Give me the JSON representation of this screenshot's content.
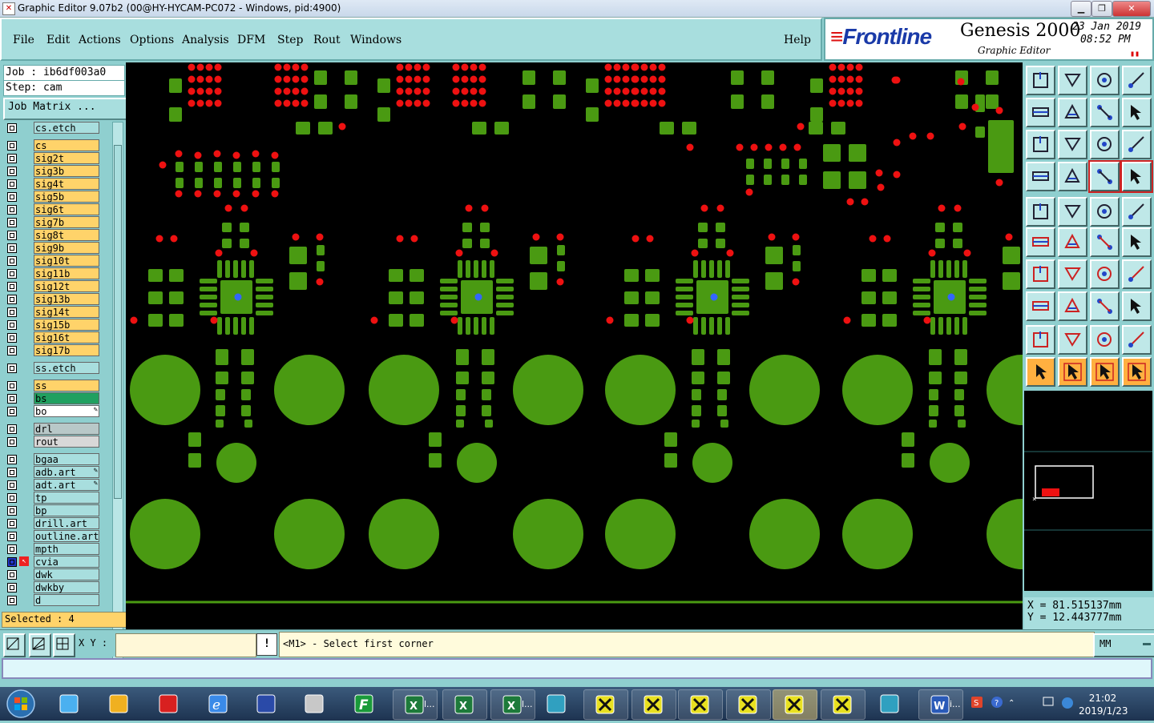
{
  "window": {
    "title": "Graphic Editor 9.07b2 (00@HY-HYCAM-PC072 - Windows, pid:4900)"
  },
  "menu": {
    "items": [
      "File",
      "Edit",
      "Actions",
      "Options",
      "Analysis",
      "DFM",
      "Step",
      "Rout",
      "Windows"
    ],
    "help": "Help"
  },
  "brand": {
    "logo": "Frontline",
    "product": "Genesis 2000",
    "subtitle": "Graphic Editor",
    "date": "23 Jan 2019",
    "time": "08:52 PM"
  },
  "job": {
    "job_label": "Job : ib6df003a0",
    "step_label": "Step: cam",
    "matrix_button": "Job Matrix ..."
  },
  "layers": [
    {
      "name": "cs.etch",
      "color": "#a8dede",
      "group": "a"
    },
    {
      "name": "cs",
      "color": "#ffd36a",
      "group": "b"
    },
    {
      "name": "sig2t",
      "color": "#ffd36a",
      "group": "b"
    },
    {
      "name": "sig3b",
      "color": "#ffd36a",
      "group": "b"
    },
    {
      "name": "sig4t",
      "color": "#ffd36a",
      "group": "b"
    },
    {
      "name": "sig5b",
      "color": "#ffd36a",
      "group": "b"
    },
    {
      "name": "sig6t",
      "color": "#ffd36a",
      "group": "b"
    },
    {
      "name": "sig7b",
      "color": "#ffd36a",
      "group": "b"
    },
    {
      "name": "sig8t",
      "color": "#ffd36a",
      "group": "b"
    },
    {
      "name": "sig9b",
      "color": "#ffd36a",
      "group": "b"
    },
    {
      "name": "sig10t",
      "color": "#ffd36a",
      "group": "b"
    },
    {
      "name": "sig11b",
      "color": "#ffd36a",
      "group": "b"
    },
    {
      "name": "sig12t",
      "color": "#ffd36a",
      "group": "b"
    },
    {
      "name": "sig13b",
      "color": "#ffd36a",
      "group": "b"
    },
    {
      "name": "sig14t",
      "color": "#ffd36a",
      "group": "b"
    },
    {
      "name": "sig15b",
      "color": "#ffd36a",
      "group": "b"
    },
    {
      "name": "sig16t",
      "color": "#ffd36a",
      "group": "b"
    },
    {
      "name": "sig17b",
      "color": "#ffd36a",
      "group": "b"
    },
    {
      "name": "ss.etch",
      "color": "#a8dede",
      "group": "c"
    },
    {
      "name": "ss",
      "color": "#ffd36a",
      "group": "d"
    },
    {
      "name": "bs",
      "color": "#20a060",
      "group": "d"
    },
    {
      "name": "bo",
      "color": "#ffffff",
      "group": "d"
    },
    {
      "name": "drl",
      "color": "#b8c8c8",
      "group": "e"
    },
    {
      "name": "rout",
      "color": "#d8d8d8",
      "group": "e"
    },
    {
      "name": "bgaa",
      "color": "#a8dede",
      "group": "f"
    },
    {
      "name": "adb.art",
      "color": "#a8dede",
      "group": "f"
    },
    {
      "name": "adt.art",
      "color": "#a8dede",
      "group": "f"
    },
    {
      "name": "tp",
      "color": "#a8dede",
      "group": "f"
    },
    {
      "name": "bp",
      "color": "#a8dede",
      "group": "f"
    },
    {
      "name": "drill.art",
      "color": "#a8dede",
      "group": "f"
    },
    {
      "name": "outline.art",
      "color": "#a8dede",
      "group": "f"
    },
    {
      "name": "mpth",
      "color": "#a8dede",
      "group": "f"
    },
    {
      "name": "cvia",
      "color": "#a8dede",
      "group": "f"
    },
    {
      "name": "dwk",
      "color": "#a8dede",
      "group": "f"
    },
    {
      "name": "dwkby",
      "color": "#a8dede",
      "group": "f"
    },
    {
      "name": "d",
      "color": "#a8dede",
      "group": "f"
    }
  ],
  "selected": "Selected : 4",
  "coords": {
    "x": "X = 81.515137mm",
    "y": "Y = 12.443777mm"
  },
  "command": {
    "xy_label": "X Y :",
    "xy_value": "",
    "prompt": "<M1> - Select first corner",
    "units": "MM"
  },
  "colors": {
    "copper": "#4a9a12",
    "drill": "#ee1111",
    "via": "#3366ff",
    "panel": "#8fcfcf"
  },
  "taskbar": {
    "clock_time": "21:02",
    "clock_date": "2019/1/23",
    "excel_label": "l...",
    "word_label": "i..."
  }
}
